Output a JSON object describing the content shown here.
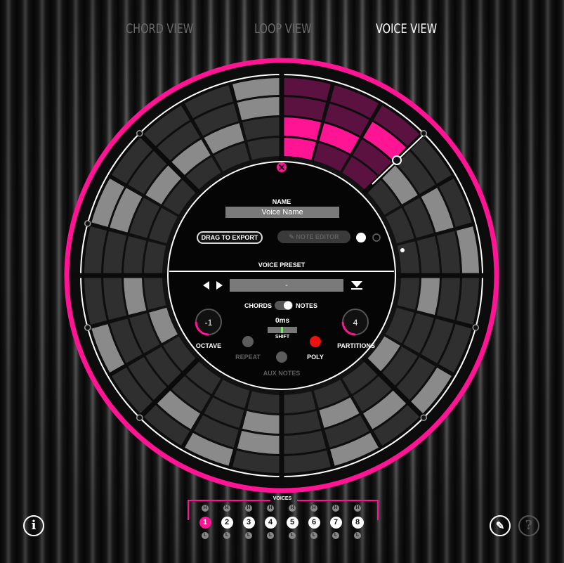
{
  "tabs": [
    {
      "label": "CHORD VIEW",
      "active": false
    },
    {
      "label": "LOOP VIEW",
      "active": false
    },
    {
      "label": "VOICE VIEW",
      "active": true
    }
  ],
  "colors": {
    "accent": "#ff1493",
    "inactive_tab": "#6a6a6a",
    "active_tab": "#ffffff"
  },
  "editor": {
    "name_label": "NAME",
    "voice_name": "Voice Name",
    "drag_export_label": "DRAG TO EXPORT",
    "note_editor_label": "✎ NOTE EDITOR",
    "voice_preset_label": "VOICE PRESET",
    "preset_value": "-",
    "chords_label": "CHORDS",
    "notes_label": "NOTES",
    "octave_value": "-1",
    "octave_label": "OCTAVE",
    "shift_value": "0ms",
    "shift_label": "SHIFT",
    "partitions_value": "4",
    "partitions_label": "PARTITIONS",
    "repeat_label": "REPEAT",
    "poly_label": "POLY",
    "aux_notes_label": "AUX NOTES"
  },
  "voices": {
    "label": "VOICES",
    "items": [
      "1",
      "2",
      "3",
      "4",
      "5",
      "6",
      "7",
      "8"
    ],
    "selected": "1",
    "top_marker": "H",
    "bottom_marker": "L"
  },
  "icons": [
    "info-icon",
    "lightbulb-icon",
    "help-icon",
    "close-icon",
    "arrow-left-icon",
    "arrow-right-icon",
    "download-icon"
  ]
}
